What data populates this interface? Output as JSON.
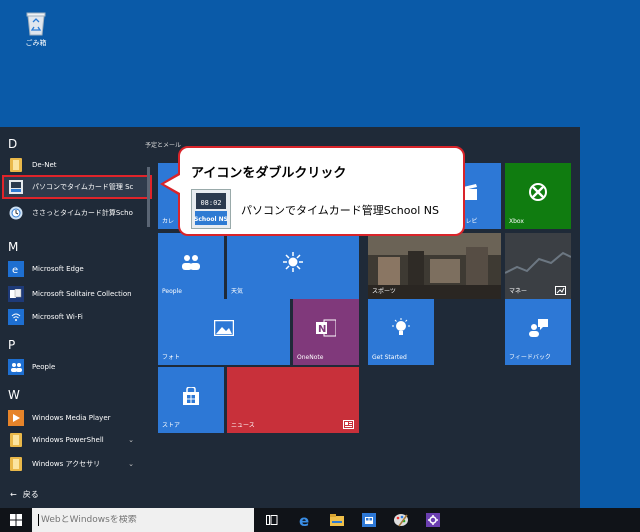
{
  "desktop": {
    "recycle_bin_label": "ごみ箱"
  },
  "start_menu": {
    "letters": [
      "D",
      "M",
      "P",
      "W"
    ],
    "apps": [
      {
        "label": "De-Net",
        "icon": "folder-icon"
      },
      {
        "label": "パソコンでタイムカード管理 Sc",
        "icon": "timecard-app-icon"
      },
      {
        "label": "ささっとタイムカード計算Scho",
        "icon": "timecard-calc-icon"
      },
      {
        "label": "Microsoft Edge",
        "icon": "edge-icon"
      },
      {
        "label": "Microsoft Solitaire Collection",
        "icon": "solitaire-icon"
      },
      {
        "label": "Microsoft Wi-Fi",
        "icon": "wifi-icon"
      },
      {
        "label": "People",
        "icon": "people-icon"
      },
      {
        "label": "Windows Media Player",
        "icon": "media-player-icon"
      },
      {
        "label": "Windows PowerShell",
        "icon": "folder-icon"
      },
      {
        "label": "Windows アクセサリ",
        "icon": "folder-icon"
      }
    ],
    "chevron": "⌄",
    "back_label": "戻る",
    "group_label": "予定とメール",
    "tiles": [
      {
        "label": "カレ",
        "icon": "calendar-icon"
      },
      {
        "label": "映画 & テレビ",
        "icon": "movie-icon"
      },
      {
        "label": "Xbox",
        "icon": "xbox-icon"
      },
      {
        "label": "People",
        "icon": "people-icon"
      },
      {
        "label": "天気",
        "icon": "weather-icon"
      },
      {
        "label": "スポーツ",
        "icon": "sports-icon"
      },
      {
        "label": "マネー",
        "icon": "money-icon"
      },
      {
        "label": "フォト",
        "icon": "photo-icon"
      },
      {
        "label": "OneNote",
        "icon": "onenote-icon"
      },
      {
        "label": "Get Started",
        "icon": "lightbulb-icon"
      },
      {
        "label": "フィードバック",
        "icon": "feedback-icon"
      },
      {
        "label": "ストア",
        "icon": "store-icon"
      },
      {
        "label": "ニュース",
        "icon": "news-icon"
      }
    ]
  },
  "callout": {
    "title": "アイコンをダブルクリック",
    "app_name": "パソコンでタイムカード管理School NS",
    "app_icon_clock": "08:02",
    "app_icon_text": "School NS"
  },
  "taskbar": {
    "search_placeholder": "WebとWindowsを検索"
  },
  "colors": {
    "desktop": "#0a5aa8",
    "start_bg": "#1f2a38",
    "tile_blue": "#2d78d6",
    "xbox_green": "#107c10",
    "onenote_purple": "#80397b",
    "news_red": "#c8303a",
    "highlight_red": "#e0242a"
  }
}
